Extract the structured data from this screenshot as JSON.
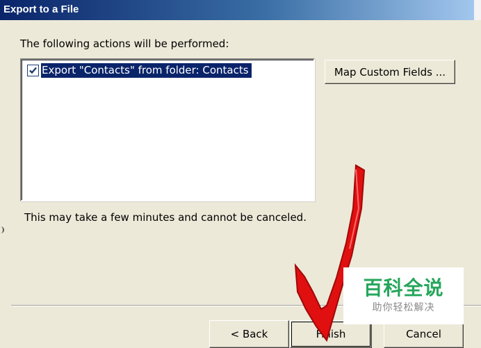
{
  "window": {
    "title": "Export to a File"
  },
  "main": {
    "instruction": "The following actions will be performed:",
    "actions": [
      {
        "label": "Export \"Contacts\" from folder: Contacts",
        "checked": true
      }
    ],
    "note": "This may take a few minutes and cannot be canceled."
  },
  "buttons": {
    "map_custom_fields": "Map Custom Fields ...",
    "back": "< Back",
    "finish": "Finish",
    "cancel": "Cancel"
  },
  "watermark": {
    "title": "百科全说",
    "subtitle": "助你轻松解决"
  },
  "colors": {
    "title_bar": "#0a246a",
    "selection": "#0a246a",
    "dialog_bg": "#ece9d8",
    "annotation_arrow": "#e01010",
    "watermark_text": "#26a65b"
  }
}
